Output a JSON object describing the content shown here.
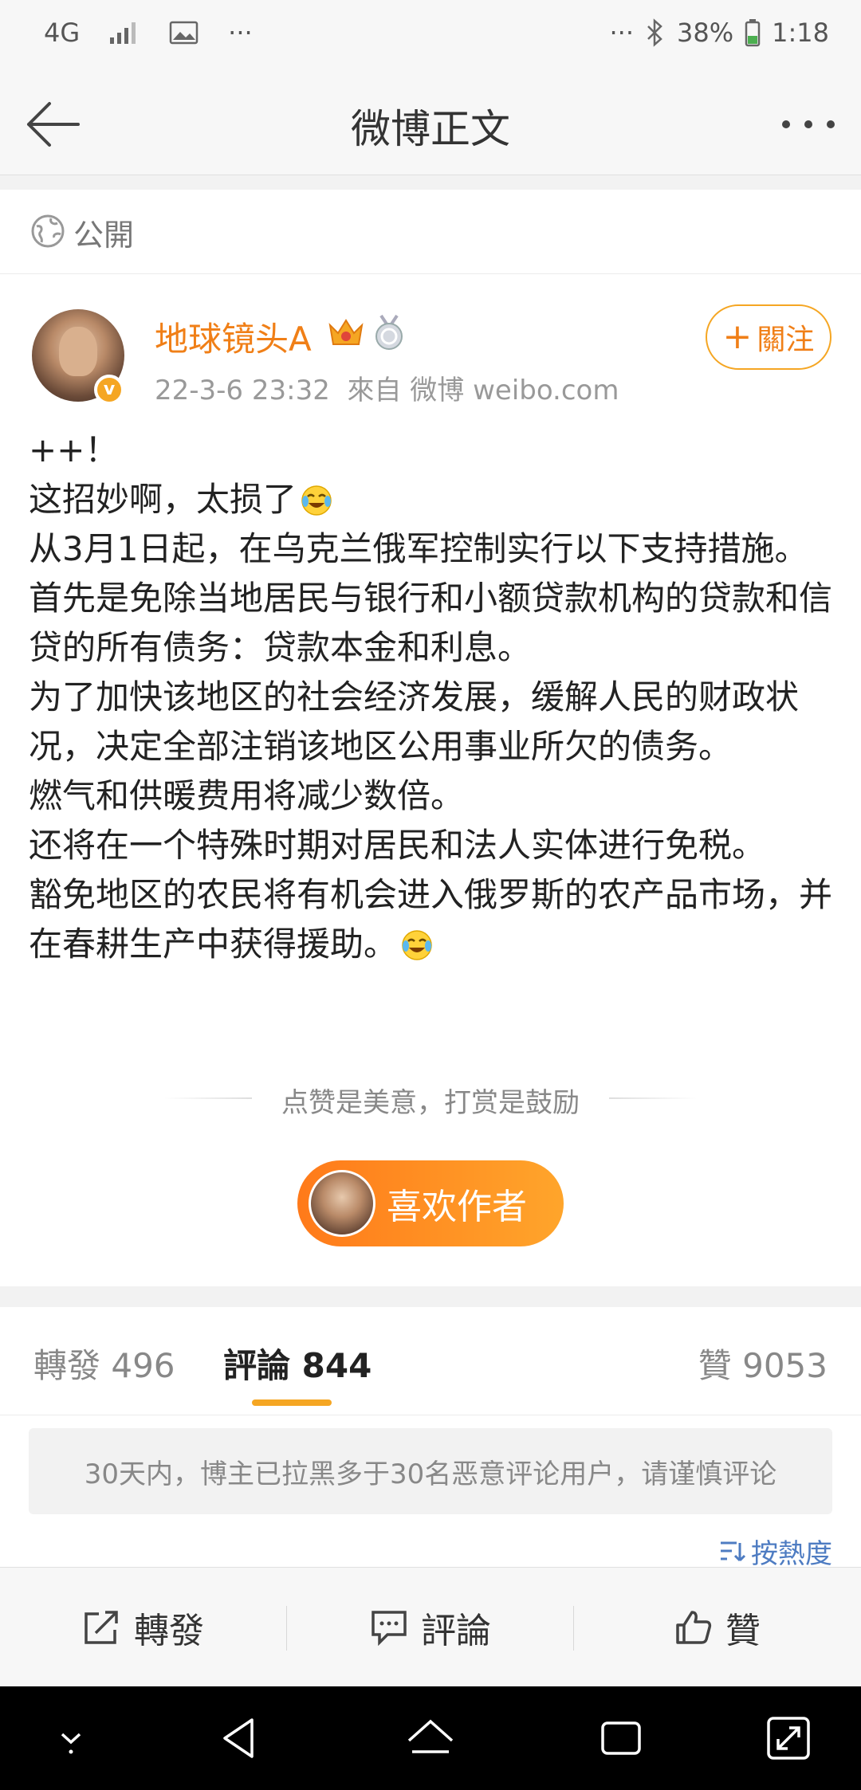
{
  "status_bar": {
    "network": "4G",
    "dots_left": "···",
    "dots_right": "···",
    "battery": "38%",
    "time": "1:18"
  },
  "nav": {
    "title": "微博正文"
  },
  "visibility": {
    "label": "公開"
  },
  "post": {
    "author": "地球镜头A",
    "time": "22-3-6 23:32",
    "source": "來自 微博 weibo.com",
    "follow_label": "關注",
    "text": {
      "line1": "++！",
      "line2": "这招妙啊，太损了",
      "line3": "从3月1日起，在乌克兰俄军控制实行以下支持措施。",
      "line4": "首先是免除当地居民与银行和小额贷款机构的贷款和信贷的所有债务：贷款本金和利息。",
      "line5": "为了加快该地区的社会经济发展，缓解人民的财政状况，决定全部注销该地区公用事业所欠的债务。",
      "line6": "燃气和供暖费用将减少数倍。",
      "line7": "还将在一个特殊时期对居民和法人实体进行免税。",
      "line8": "豁免地区的农民将有机会进入俄罗斯的农产品市场，并在春耕生产中获得援助。"
    },
    "reward_hint": "点赞是美意，打赏是鼓励",
    "like_author_label": "喜欢作者"
  },
  "tabs": {
    "repost": "轉發 496",
    "comment": "評論 844",
    "like": "贊 9053"
  },
  "comments": {
    "notice": "30天内，博主已拉黑多于30名恶意评论用户，请谨慎评论",
    "sort_label": "按熱度"
  },
  "actions": {
    "repost": "轉發",
    "comment": "評論",
    "like": "贊"
  },
  "colors": {
    "accent_orange": "#f07f17",
    "button_gradient_start": "#ff7a1a",
    "button_gradient_end": "#ffa52b",
    "link_blue": "#4e7cc2"
  }
}
